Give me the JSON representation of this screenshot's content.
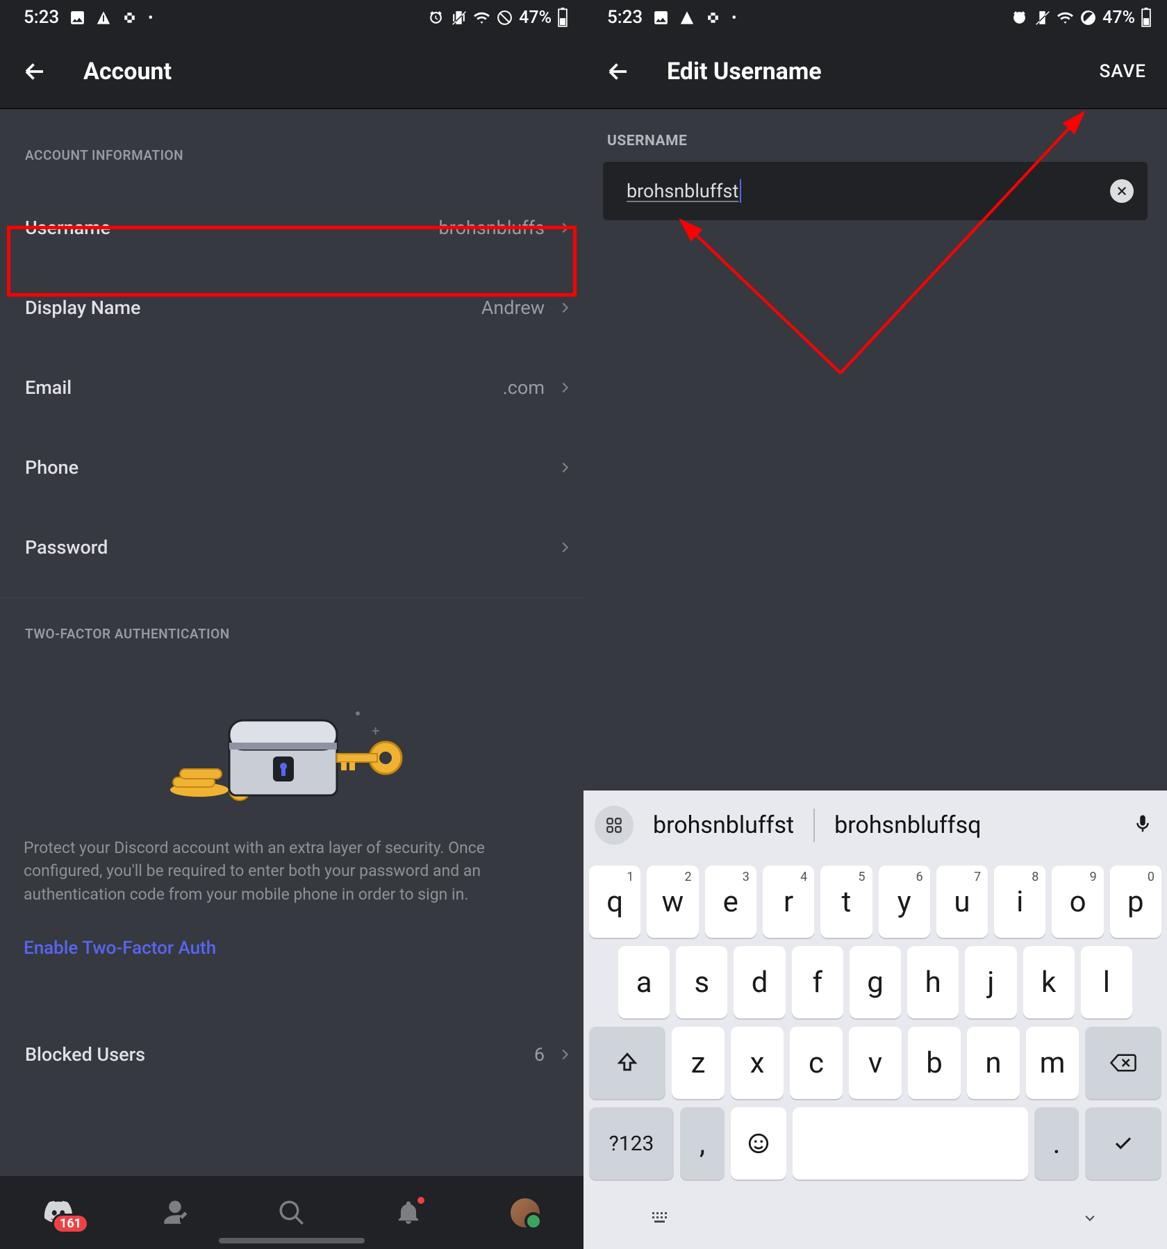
{
  "status": {
    "time": "5:23",
    "battery_pct": "47%"
  },
  "left": {
    "title": "Account",
    "section1": "ACCOUNT INFORMATION",
    "rows": {
      "username": {
        "label": "Username",
        "value": "brohsnbluffs"
      },
      "display": {
        "label": "Display Name",
        "value": "Andrew"
      },
      "email": {
        "label": "Email",
        "value": ".com"
      },
      "phone": {
        "label": "Phone",
        "value": ""
      },
      "password": {
        "label": "Password",
        "value": ""
      }
    },
    "section2": "TWO-FACTOR AUTHENTICATION",
    "tfa_desc": "Protect your Discord account with an extra layer of security. Once configured, you'll be required to enter both your password and an authentication code from your mobile phone in order to sign in.",
    "tfa_link": "Enable Two-Factor Auth",
    "blocked": {
      "label": "Blocked Users",
      "value": "6"
    },
    "nav_badge": "161"
  },
  "right": {
    "title": "Edit Username",
    "save": "SAVE",
    "field_label": "USERNAME",
    "field_value": "brohsnbluffst",
    "suggestions": [
      "brohsnbluffst",
      "brohsnbluffsq"
    ],
    "keyboard": {
      "row1": [
        [
          "q",
          "1"
        ],
        [
          "w",
          "2"
        ],
        [
          "e",
          "3"
        ],
        [
          "r",
          "4"
        ],
        [
          "t",
          "5"
        ],
        [
          "y",
          "6"
        ],
        [
          "u",
          "7"
        ],
        [
          "i",
          "8"
        ],
        [
          "o",
          "9"
        ],
        [
          "p",
          "0"
        ]
      ],
      "row2": [
        "a",
        "s",
        "d",
        "f",
        "g",
        "h",
        "j",
        "k",
        "l"
      ],
      "row3": [
        "z",
        "x",
        "c",
        "v",
        "b",
        "n",
        "m"
      ],
      "fn": "?123",
      "comma": ",",
      "period": "."
    }
  }
}
